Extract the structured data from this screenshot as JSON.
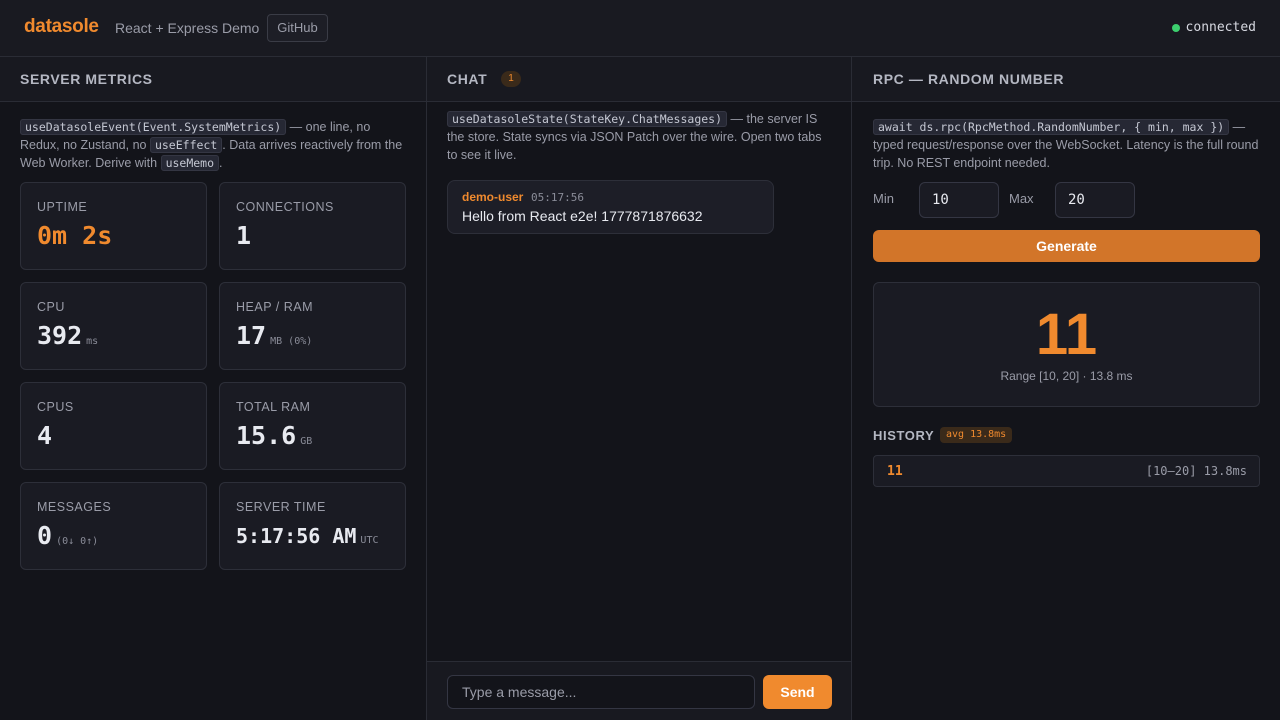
{
  "header": {
    "brand": "datasole",
    "subtitle": "React + Express Demo",
    "github_label": "GitHub",
    "status_text": "connected",
    "status_color": "#3ccf6e"
  },
  "metrics": {
    "title": "SERVER METRICS",
    "desc": {
      "code1": "useDatasoleEvent(Event.SystemMetrics)",
      "text1": " — one line, no Redux, no Zustand, no ",
      "code2": "useEffect",
      "text2": ". Data arrives reactively from the Web Worker. Derive with ",
      "code3": "useMemo",
      "text3": "."
    },
    "cards": {
      "uptime": {
        "label": "UPTIME",
        "value": "0m 2s"
      },
      "connections": {
        "label": "CONNECTIONS",
        "value": "1"
      },
      "cpu": {
        "label": "CPU",
        "value": "392",
        "unit": "ms"
      },
      "heap": {
        "label": "HEAP / RAM",
        "value": "17",
        "unit": "MB (0%)"
      },
      "cpus": {
        "label": "CPUS",
        "value": "4"
      },
      "total_ram": {
        "label": "TOTAL RAM",
        "value": "15.6",
        "unit": "GB"
      },
      "messages": {
        "label": "MESSAGES",
        "value": "0",
        "unit": "(0↓ 0↑)"
      },
      "server_time": {
        "label": "SERVER TIME",
        "value": "5:17:56 AM",
        "unit": "UTC"
      }
    }
  },
  "chat": {
    "title": "CHAT",
    "badge": "1",
    "desc": {
      "code1": "useDatasoleState(StateKey.ChatMessages)",
      "text1": " — the server IS the store. State syncs via JSON Patch over the wire. Open two tabs to see it live."
    },
    "messages": [
      {
        "user": "demo-user",
        "time": "05:17:56",
        "text": "Hello from React e2e! 1777871876632"
      }
    ],
    "input_placeholder": "Type a message...",
    "send_label": "Send"
  },
  "rpc": {
    "title": "RPC — RANDOM NUMBER",
    "desc": {
      "code1": "await ds.rpc(RpcMethod.RandomNumber, { min, max })",
      "text1": " — typed request/response over the WebSocket. Latency is the full round trip. No REST endpoint needed."
    },
    "min_label": "Min",
    "min_value": "10",
    "max_label": "Max",
    "max_value": "20",
    "generate_label": "Generate",
    "result": {
      "value": "11",
      "meta": "Range [10, 20] · 13.8 ms"
    },
    "history": {
      "title": "HISTORY",
      "badge": "avg 13.8ms",
      "items": [
        {
          "value": "11",
          "meta": "[10–20] 13.8ms"
        }
      ]
    }
  },
  "colors": {
    "accent": "#f08a2e",
    "background": "#13141a"
  }
}
